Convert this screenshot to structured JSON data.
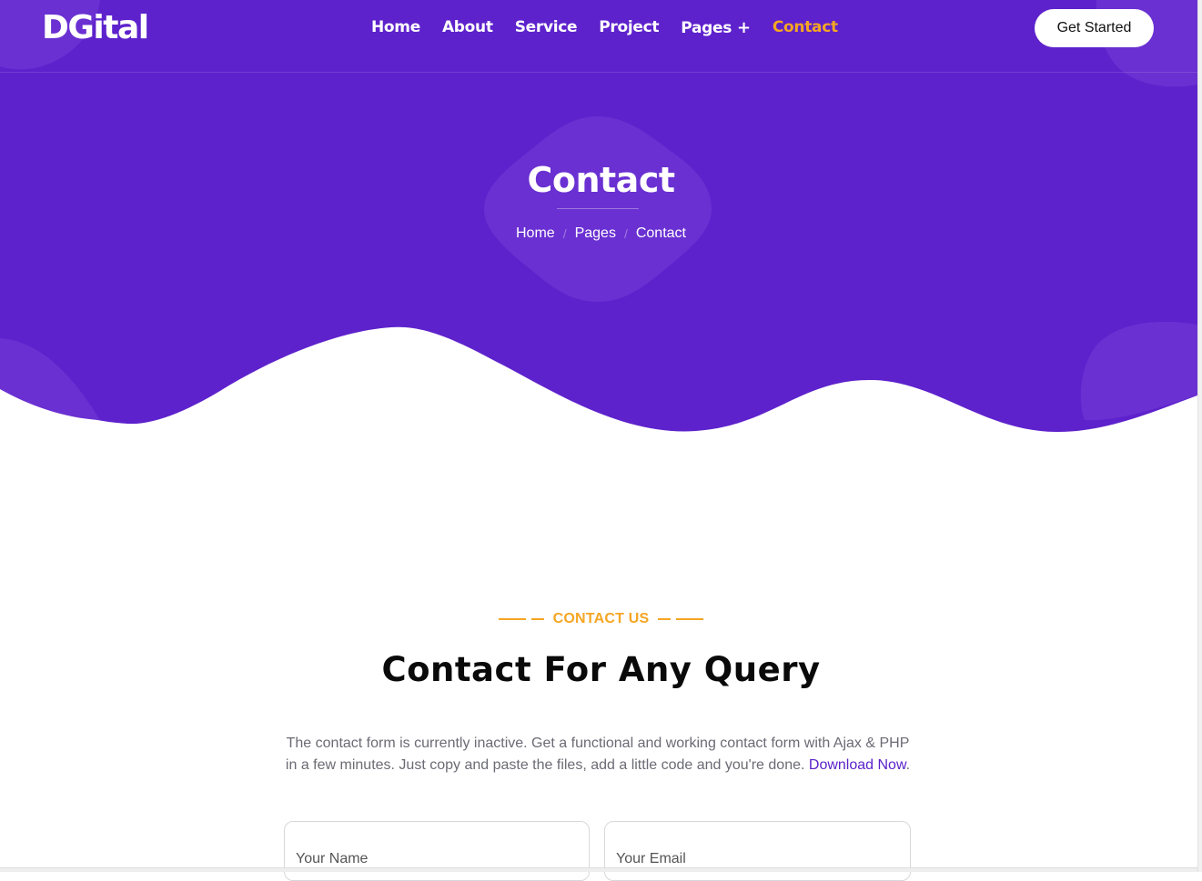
{
  "brand": "DGital",
  "nav": {
    "items": [
      {
        "label": "Home"
      },
      {
        "label": "About"
      },
      {
        "label": "Service"
      },
      {
        "label": "Project"
      },
      {
        "label": "Pages"
      },
      {
        "label": "Contact"
      }
    ],
    "pages_dropdown_glyph": "+",
    "active": "Contact",
    "cta_label": "Get Started"
  },
  "hero": {
    "title": "Contact",
    "breadcrumb": [
      "Home",
      "Pages",
      "Contact"
    ],
    "separator": "/"
  },
  "contact_section": {
    "tag": "CONTACT US",
    "title": "Contact For Any Query",
    "description": "The contact form is currently inactive. Get a functional and working contact form with Ajax & PHP in a few minutes. Just copy and paste the files, add a little code and you're done.",
    "link_text": "Download Now",
    "trailing": ".",
    "name_placeholder": "Your Name",
    "email_placeholder": "Your Email"
  },
  "colors": {
    "primary": "#5E22CC",
    "primary_light": "#6A30D2",
    "accent": "#F5A623",
    "link": "#5A22C9"
  },
  "icons": {
    "pages_dropdown": "plus-icon",
    "tag_ornament": "dash-ornament"
  }
}
